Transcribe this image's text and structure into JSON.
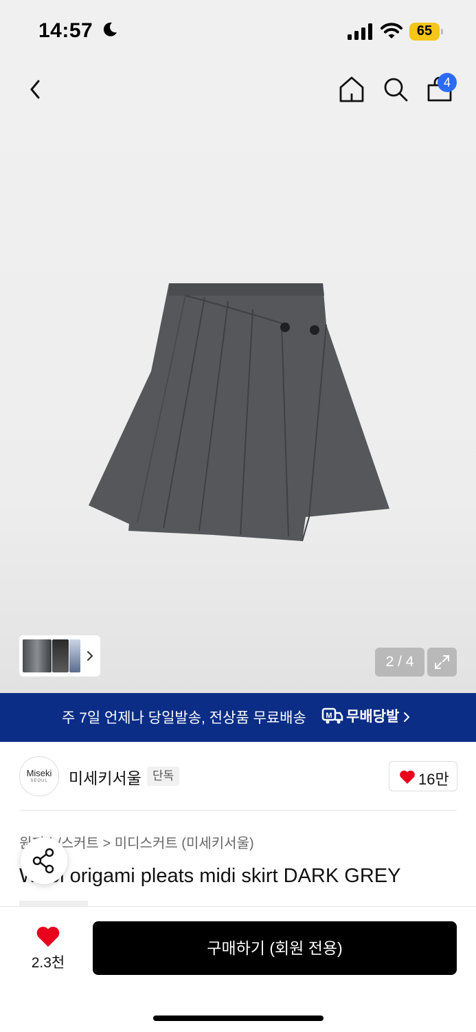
{
  "status_bar": {
    "time": "14:57",
    "battery": "65",
    "battery_color": "#f5c518"
  },
  "header": {
    "back_icon": "chevron-left-icon",
    "home_icon": "home-icon",
    "search_icon": "search-icon",
    "cart_icon": "shopping-bag-icon",
    "cart_count": "4",
    "cart_badge_color": "#2b6cf6"
  },
  "gallery": {
    "counter": "2 / 4",
    "expand_icon": "expand-icon",
    "thumbnail_chevron_icon": "chevron-right-icon"
  },
  "promo": {
    "text": "주 7일 언제나 당일발송, 전상품 무료배송",
    "logo_text": "무배당발",
    "background": "#0b2d86"
  },
  "brand": {
    "logo_main": "Miseki",
    "logo_sub": "SEOUL",
    "name": "미세키서울",
    "exclusive_label": "단독",
    "like_count": "16만"
  },
  "product": {
    "breadcrumb": "원피스/스커트 > 미디스커트 (미세키서울)",
    "title": "Wool origami pleats midi skirt DARK GREY"
  },
  "bottom_bar": {
    "wish_count": "2.3천",
    "buy_label": "구매하기 (회원 전용)",
    "heart_color": "#e8001c"
  }
}
